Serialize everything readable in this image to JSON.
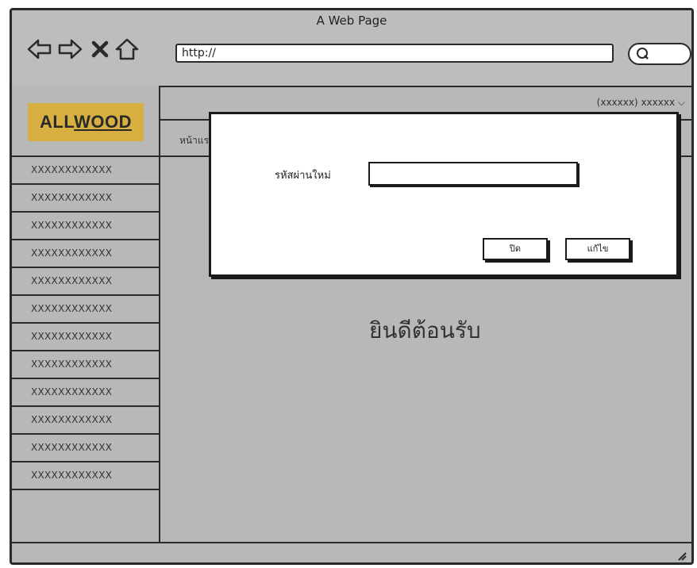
{
  "window": {
    "title": "A Web Page"
  },
  "toolbar": {
    "url": "http://",
    "icons": [
      "back-arrow-icon",
      "forward-arrow-icon",
      "close-x-icon",
      "home-icon",
      "search-icon"
    ]
  },
  "sidebar": {
    "logo": {
      "part1": "ALL",
      "part2": "WOOD"
    },
    "items": [
      {
        "label": "XXXXXXXXXXXX"
      },
      {
        "label": "XXXXXXXXXXXX"
      },
      {
        "label": "XXXXXXXXXXXX"
      },
      {
        "label": "XXXXXXXXXXXX"
      },
      {
        "label": "XXXXXXXXXXXX"
      },
      {
        "label": "XXXXXXXXXXXX"
      },
      {
        "label": "XXXXXXXXXXXX"
      },
      {
        "label": "XXXXXXXXXXXX"
      },
      {
        "label": "XXXXXXXXXXXX"
      },
      {
        "label": "XXXXXXXXXXXX"
      },
      {
        "label": "XXXXXXXXXXXX"
      },
      {
        "label": "XXXXXXXXXXXX"
      }
    ]
  },
  "header": {
    "user_menu": "(xxxxxx) xxxxxx"
  },
  "tabs": {
    "home": "หน้าแรก"
  },
  "main": {
    "welcome": "ยินดีต้อนรับ"
  },
  "modal": {
    "label": "รหัสผ่านใหม่",
    "input_value": "",
    "close_label": "ปิด",
    "edit_label": "แก้ไข"
  },
  "colors": {
    "logo_bg": "#d8b042",
    "window_bg": "#b8b8b8",
    "border": "#2a2a2a"
  }
}
